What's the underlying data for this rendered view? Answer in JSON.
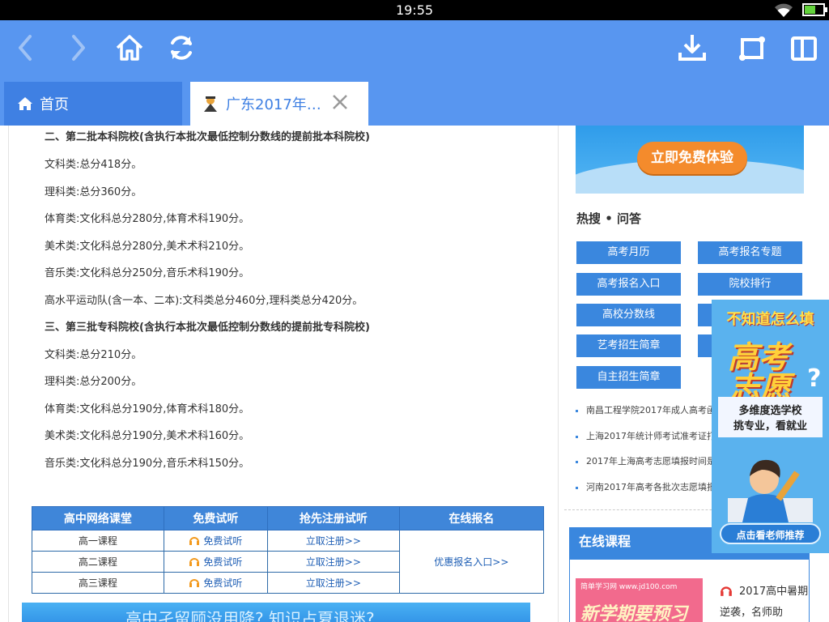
{
  "status_bar": {
    "time": "19:55"
  },
  "toolbar": {
    "back_icon": "chevron-left-icon",
    "forward_icon": "chevron-right-icon",
    "home_icon": "home-icon",
    "refresh_icon": "refresh-icon",
    "download_icon": "download-icon",
    "rotate_icon": "rotate-screen-icon",
    "fullscreen_icon": "fullscreen-icon",
    "accent": "#5896f0"
  },
  "tabs": [
    {
      "label": "首页",
      "icon": "home-icon"
    },
    {
      "label": "广东2017年…",
      "icon": "favicon-icon",
      "close_icon": "close-icon"
    }
  ],
  "article": {
    "paragraphs": [
      {
        "text": "二、第二批本科院校(含执行本批次最低控制分数线的提前批本科院校)",
        "bold": true
      },
      {
        "text": "文科类:总分418分。",
        "bold": false
      },
      {
        "text": "理科类:总分360分。",
        "bold": false
      },
      {
        "text": "体育类:文化科总分280分,体育术科190分。",
        "bold": false
      },
      {
        "text": "美术类:文化科总分280分,美术术科210分。",
        "bold": false
      },
      {
        "text": "音乐类:文化科总分250分,音乐术科190分。",
        "bold": false
      },
      {
        "text": "高水平运动队(含一本、二本):文科类总分460分,理科类总分420分。",
        "bold": false
      },
      {
        "text": "三、第三批专科院校(含执行本批次最低控制分数线的提前批专科院校)",
        "bold": true
      },
      {
        "text": "文科类:总分210分。",
        "bold": false
      },
      {
        "text": "理科类:总分200分。",
        "bold": false
      },
      {
        "text": "体育类:文化科总分190分,体育术科180分。",
        "bold": false
      },
      {
        "text": "美术类:文化科总分190分,美术术科160分。",
        "bold": false
      },
      {
        "text": "音乐类:文化科总分190分,音乐术科150分。",
        "bold": false
      }
    ]
  },
  "course_table": {
    "headers": [
      "高中网络课堂",
      "免费试听",
      "抢先注册试听",
      "在线报名"
    ],
    "rows": [
      {
        "course": "高一课程",
        "listen": "免费试听",
        "register": "立取注册>>"
      },
      {
        "course": "高二课程",
        "listen": "免费试听",
        "register": "立取注册>>"
      },
      {
        "course": "高三课程",
        "listen": "免费试听",
        "register": "立取注册>>"
      }
    ],
    "signup": "优惠报名入口>>"
  },
  "bottom_banner": {
    "text": "高中孑留顾没用降? 知识占夏退迷?"
  },
  "sidebar": {
    "trial_button": "立即免费体验",
    "hot_title": "热搜 • 问答",
    "hot_links": [
      "高考月历",
      "高考报名专题",
      "高考报名入口",
      "院校排行",
      "高校分数线",
      "",
      "艺考招生简章",
      "",
      "自主招生简章"
    ],
    "news": [
      "南昌工程学院2017年成人高考函授招生",
      "上海2017年统计师考试准考证打印官网网",
      "2017年上海高考志愿填报时间是几时?",
      "河南2017年高考各批次志愿填报什么时候"
    ],
    "online_title": "在线课程",
    "course_logo": "简单学习网 www.jd100.com",
    "course_banner": "新学期要预习",
    "course_desc": "2017高中暑期逆袭，名师助"
  },
  "float_ad": {
    "top": "不知道怎么填",
    "big1": "高考",
    "big2": "志愿",
    "q": "?",
    "sub1": "多维度选学校",
    "sub2": "挑专业，看就业",
    "cta": "点击看老师推荐"
  }
}
